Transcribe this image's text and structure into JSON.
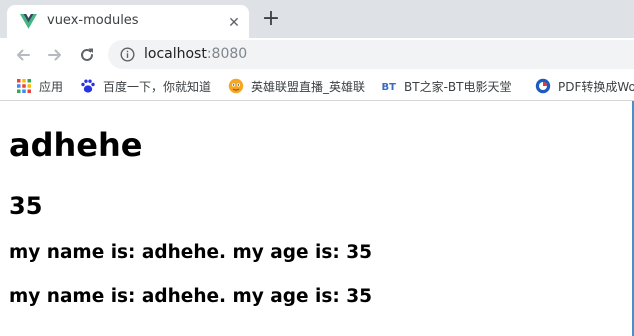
{
  "browser": {
    "tab": {
      "title": "vuex-modules",
      "close_glyph": "✕",
      "favicon": "vue-logo-icon"
    },
    "new_tab_glyph": "+",
    "url": {
      "host": "localhost",
      "port": ":8080"
    },
    "icons": [
      "back-arrow-icon",
      "forward-arrow-icon",
      "reload-icon",
      "info-icon"
    ],
    "bookmarks": [
      {
        "label": "应用",
        "icon": "apps-grid-icon"
      },
      {
        "label": "百度一下，你就知道",
        "icon": "baidu-paw-icon"
      },
      {
        "label": "英雄联盟直播_英雄联",
        "icon": "lol-stream-icon"
      },
      {
        "label": "BT之家-BT电影天堂",
        "icon": "bt-icon"
      },
      {
        "label": "PDF转换成Wo",
        "icon": "pdf-converter-icon"
      }
    ]
  },
  "page": {
    "name": "adhehe",
    "age": "35",
    "lines": [
      "my name is: adhehe. my age is: 35",
      "my name is: adhehe. my age is: 35"
    ]
  },
  "colors": {
    "tabstrip": "#dee1e6",
    "omnibox": "#f1f3f4",
    "vue_green": "#41b883",
    "vue_dark": "#35495e"
  }
}
